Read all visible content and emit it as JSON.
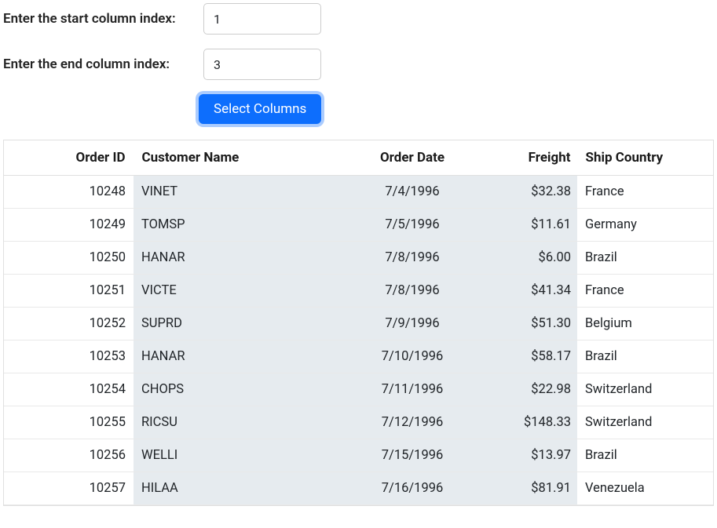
{
  "controls": {
    "start_label": "Enter the start column index:",
    "end_label": "Enter the end column index:",
    "start_value": "1",
    "end_value": "3",
    "button_label": "Select Columns"
  },
  "grid": {
    "columns": [
      {
        "key": "orderId",
        "label": "Order ID",
        "cls": "col-orderid"
      },
      {
        "key": "customer",
        "label": "Customer Name",
        "cls": "col-customer"
      },
      {
        "key": "date",
        "label": "Order Date",
        "cls": "col-date"
      },
      {
        "key": "freight",
        "label": "Freight",
        "cls": "col-freight"
      },
      {
        "key": "country",
        "label": "Ship Country",
        "cls": "col-country"
      }
    ],
    "rows": [
      {
        "orderId": "10248",
        "customer": "VINET",
        "date": "7/4/1996",
        "freight": "$32.38",
        "country": "France"
      },
      {
        "orderId": "10249",
        "customer": "TOMSP",
        "date": "7/5/1996",
        "freight": "$11.61",
        "country": "Germany"
      },
      {
        "orderId": "10250",
        "customer": "HANAR",
        "date": "7/8/1996",
        "freight": "$6.00",
        "country": "Brazil"
      },
      {
        "orderId": "10251",
        "customer": "VICTE",
        "date": "7/8/1996",
        "freight": "$41.34",
        "country": "France"
      },
      {
        "orderId": "10252",
        "customer": "SUPRD",
        "date": "7/9/1996",
        "freight": "$51.30",
        "country": "Belgium"
      },
      {
        "orderId": "10253",
        "customer": "HANAR",
        "date": "7/10/1996",
        "freight": "$58.17",
        "country": "Brazil"
      },
      {
        "orderId": "10254",
        "customer": "CHOPS",
        "date": "7/11/1996",
        "freight": "$22.98",
        "country": "Switzerland"
      },
      {
        "orderId": "10255",
        "customer": "RICSU",
        "date": "7/12/1996",
        "freight": "$148.33",
        "country": "Switzerland"
      },
      {
        "orderId": "10256",
        "customer": "WELLI",
        "date": "7/15/1996",
        "freight": "$13.97",
        "country": "Brazil"
      },
      {
        "orderId": "10257",
        "customer": "HILAA",
        "date": "7/16/1996",
        "freight": "$81.91",
        "country": "Venezuela"
      }
    ],
    "selected_col_start": 1,
    "selected_col_end": 3
  }
}
